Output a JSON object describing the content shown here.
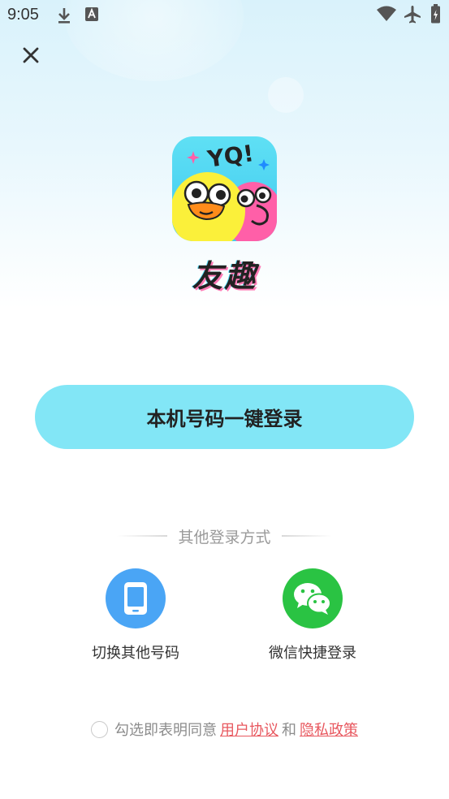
{
  "status_bar": {
    "time": "9:05",
    "icons": [
      "download-icon",
      "a-keyboard-icon",
      "wifi-icon",
      "airplane-mode-icon",
      "battery-icon"
    ]
  },
  "header": {
    "close_icon": "close-icon"
  },
  "logo": {
    "badge_text": "YQ!",
    "brand_name": "友趣"
  },
  "primary_login": {
    "label": "本机号码一键登录",
    "color": "#82e6f6"
  },
  "other_login": {
    "title": "其他登录方式",
    "options": [
      {
        "label": "切换其他号码",
        "icon": "phone-icon",
        "color": "#4aa5f5"
      },
      {
        "label": "微信快捷登录",
        "icon": "wechat-icon",
        "color": "#2ac343"
      }
    ]
  },
  "agreement": {
    "prefix": "勾选即表明同意",
    "user_agreement": "用户协议",
    "conjunction": "和",
    "privacy_policy": "隐私政策",
    "link_color": "#e8585f"
  }
}
